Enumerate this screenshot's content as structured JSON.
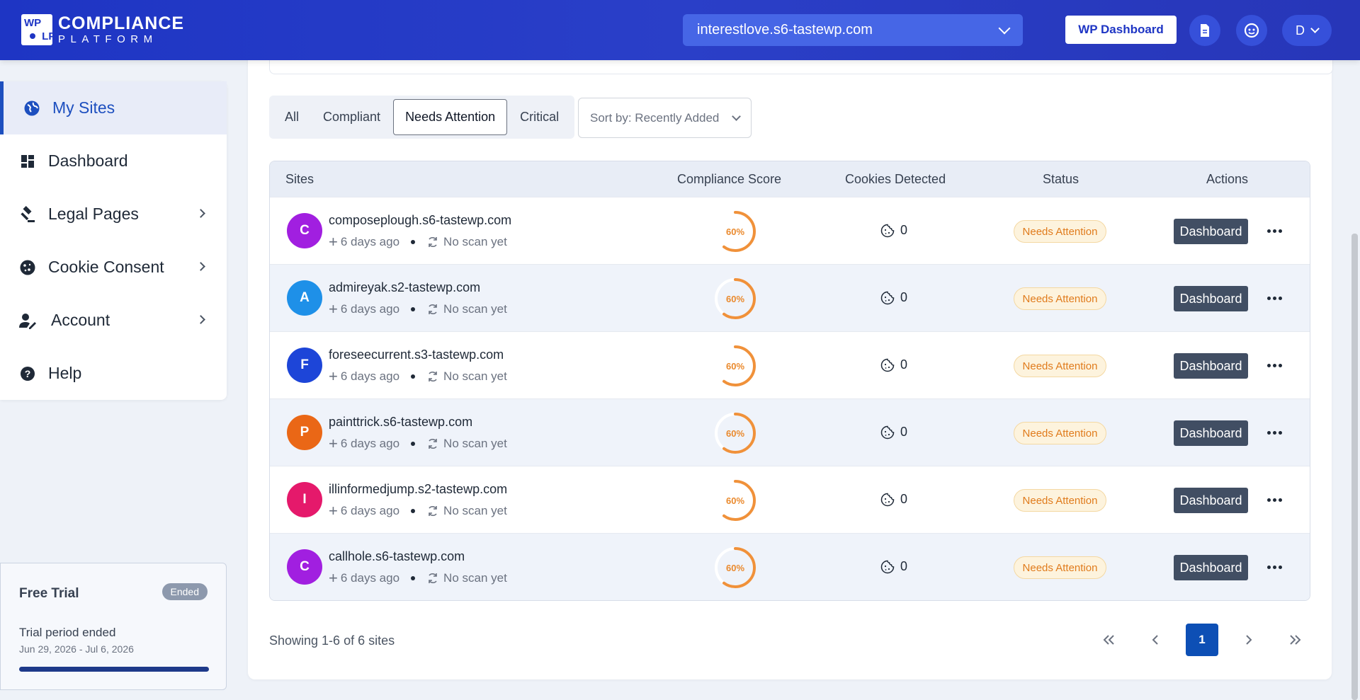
{
  "header": {
    "logo_grid": [
      "WP",
      "",
      "",
      "LP"
    ],
    "logo_line1": "COMPLIANCE",
    "logo_line2": "PLATFORM",
    "site_selector": "interestlove.s6-tastewp.com",
    "wp_dashboard_label": "WP Dashboard",
    "user_initial": "D"
  },
  "sidebar": {
    "items": [
      {
        "label": "My Sites",
        "icon": "globe-icon"
      },
      {
        "label": "Dashboard",
        "icon": "dashboard-icon"
      },
      {
        "label": "Legal Pages",
        "icon": "gavel-icon"
      },
      {
        "label": "Cookie Consent",
        "icon": "cookie-icon"
      },
      {
        "label": "Account",
        "icon": "user-edit-icon"
      },
      {
        "label": "Help",
        "icon": "help-icon"
      }
    ],
    "trial": {
      "title": "Free Trial",
      "badge": "Ended",
      "subtitle": "Trial period ended",
      "dates": "Jun 29, 2026 - Jul 6, 2026",
      "progress": 1.0
    }
  },
  "filters": {
    "tabs": [
      "All",
      "Compliant",
      "Needs Attention",
      "Critical"
    ],
    "active_tab": "Needs Attention",
    "sort_label": "Sort by: Recently Added"
  },
  "table": {
    "headers": [
      "Sites",
      "Compliance Score",
      "Cookies Detected",
      "Status",
      "Actions"
    ],
    "rows": [
      {
        "initial": "C",
        "color": "#a11fe0",
        "domain": "composeplough.s6-tastewp.com",
        "added": "6 days ago",
        "scan": "No scan yet",
        "score": "60%",
        "score_value": 0.6,
        "cookies": "0",
        "status": "Needs Attention",
        "action": "Dashboard"
      },
      {
        "initial": "A",
        "color": "#1e90e8",
        "domain": "admireyak.s2-tastewp.com",
        "added": "6 days ago",
        "scan": "No scan yet",
        "score": "60%",
        "score_value": 0.6,
        "cookies": "0",
        "status": "Needs Attention",
        "action": "Dashboard"
      },
      {
        "initial": "F",
        "color": "#1d45d8",
        "domain": "foreseecurrent.s3-tastewp.com",
        "added": "6 days ago",
        "scan": "No scan yet",
        "score": "60%",
        "score_value": 0.6,
        "cookies": "0",
        "status": "Needs Attention",
        "action": "Dashboard"
      },
      {
        "initial": "P",
        "color": "#ea6716",
        "domain": "painttrick.s6-tastewp.com",
        "added": "6 days ago",
        "scan": "No scan yet",
        "score": "60%",
        "score_value": 0.6,
        "cookies": "0",
        "status": "Needs Attention",
        "action": "Dashboard"
      },
      {
        "initial": "I",
        "color": "#e5196b",
        "domain": "illinformedjump.s2-tastewp.com",
        "added": "6 days ago",
        "scan": "No scan yet",
        "score": "60%",
        "score_value": 0.6,
        "cookies": "0",
        "status": "Needs Attention",
        "action": "Dashboard"
      },
      {
        "initial": "C",
        "color": "#a11fe0",
        "domain": "callhole.s6-tastewp.com",
        "added": "6 days ago",
        "scan": "No scan yet",
        "score": "60%",
        "score_value": 0.6,
        "cookies": "0",
        "status": "Needs Attention",
        "action": "Dashboard"
      }
    ]
  },
  "footer": {
    "showing": "Showing 1-6 of 6 sites",
    "current_page": "1"
  },
  "colors": {
    "header": "#2a3fc8",
    "accent": "#1d4fbf",
    "warning": "#ea8a2e"
  }
}
